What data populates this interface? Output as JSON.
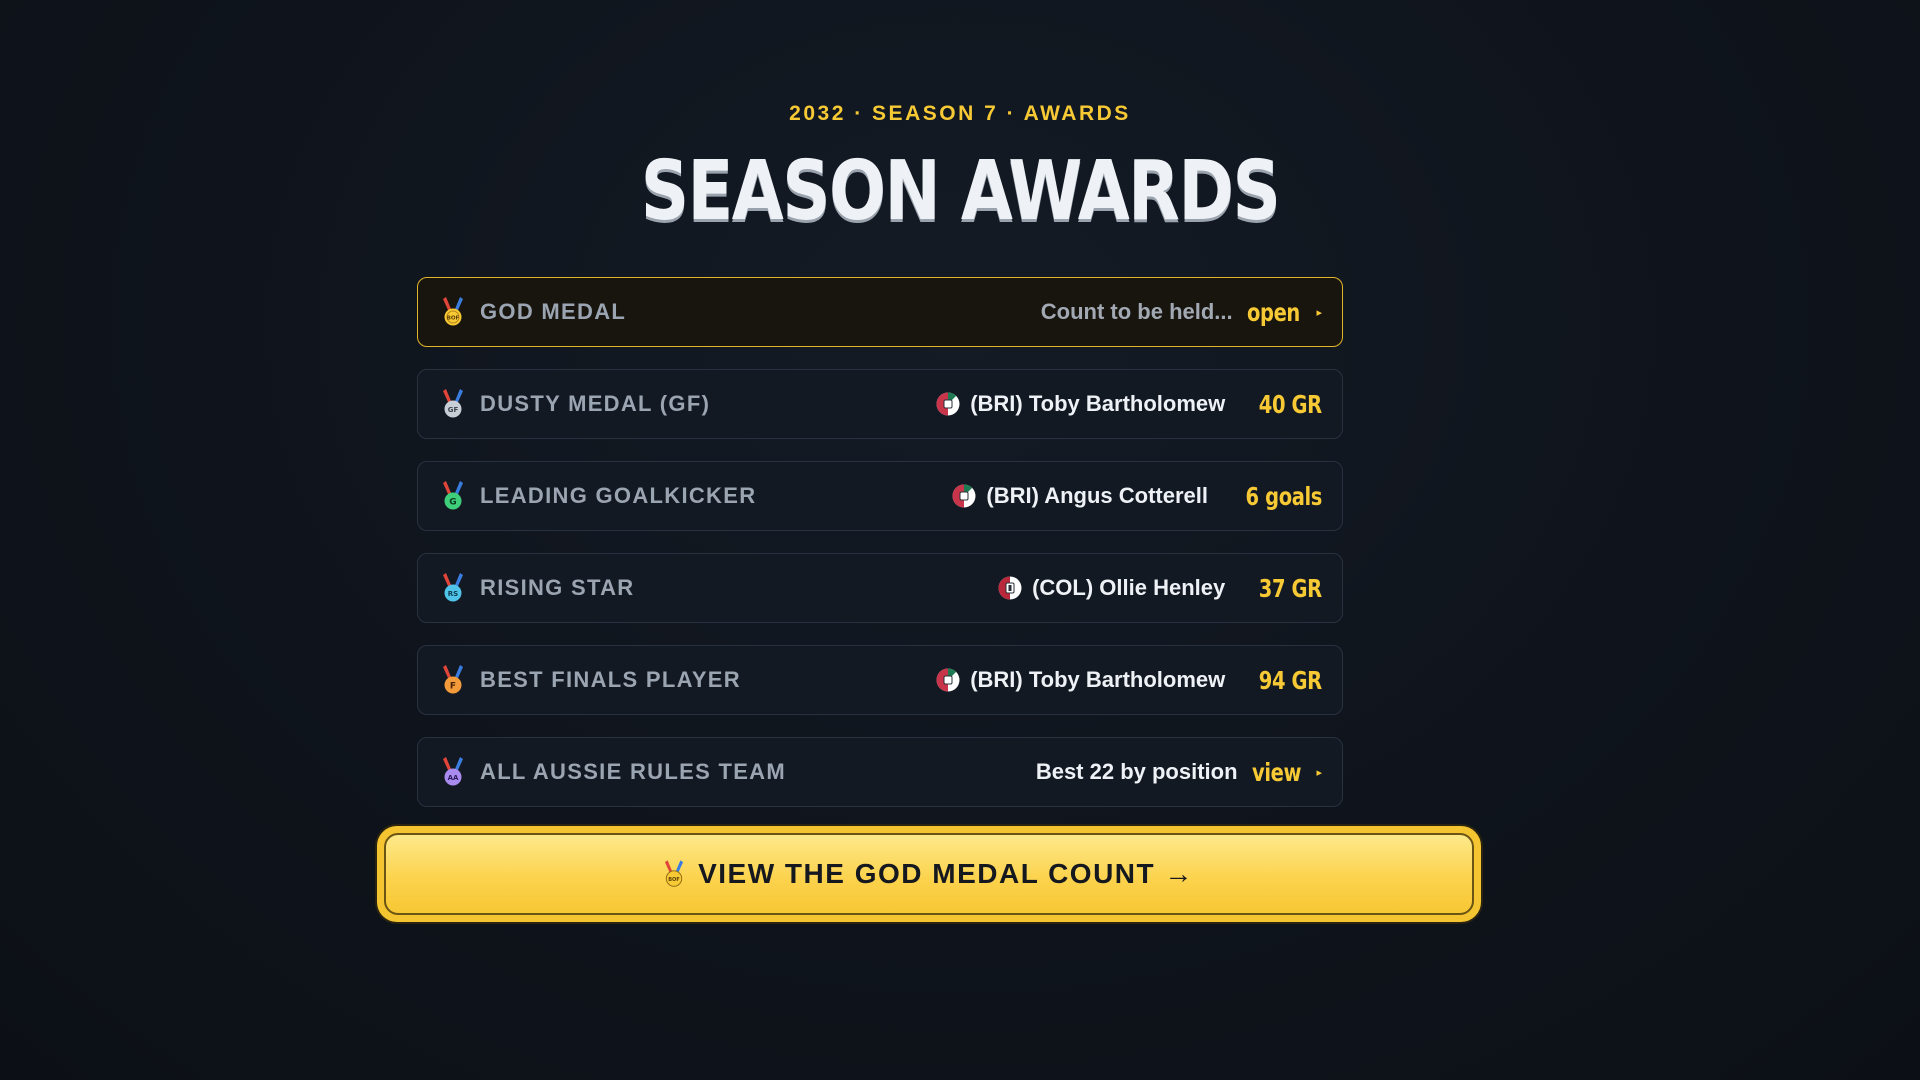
{
  "header": {
    "eyebrow": "2032 · SEASON 7 · AWARDS",
    "title": "SEASON AWARDS"
  },
  "awards": [
    {
      "label": "GOD MEDAL",
      "medal_code": "BOF",
      "medal_color": "#f7c934",
      "winner": "Count to be held...",
      "stat": "open",
      "stat_arrow": "▸",
      "featured": true
    },
    {
      "label": "DUSTY MEDAL (GF)",
      "medal_code": "GF",
      "medal_color": "#c8ced6",
      "winner": "(BRI) Toby Bartholomew",
      "stat": "40 GR",
      "badge": "bri"
    },
    {
      "label": "LEADING GOALKICKER",
      "medal_code": "G",
      "medal_color": "#3fcf7a",
      "winner": "(BRI) Angus Cotterell",
      "stat": "6 goals",
      "badge": "bri"
    },
    {
      "label": "RISING STAR",
      "medal_code": "RS",
      "medal_color": "#4fc3e8",
      "winner": "(COL) Ollie Henley",
      "stat": "37 GR",
      "badge": "col"
    },
    {
      "label": "BEST FINALS PLAYER",
      "medal_code": "F",
      "medal_color": "#f39a3a",
      "winner": "(BRI) Toby Bartholomew",
      "stat": "94 GR",
      "badge": "bri"
    },
    {
      "label": "ALL AUSSIE RULES TEAM",
      "medal_code": "AA",
      "medal_color": "#a98bf0",
      "winner": "Best 22 by position",
      "stat": "view",
      "stat_arrow": "▸"
    }
  ],
  "cta": {
    "label": "VIEW THE GOD MEDAL COUNT →",
    "medal_code": "BOF"
  },
  "colors": {
    "accent": "#f7c934",
    "background": "#0f141c",
    "row": "#121923",
    "row_border": "#283140"
  }
}
